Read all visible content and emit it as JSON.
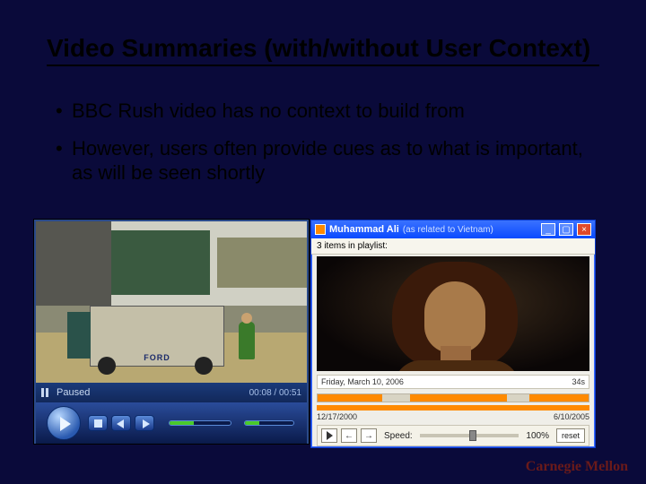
{
  "slide": {
    "title": "Video Summaries (with/without User Context)",
    "bullets": [
      "BBC Rush video has no context to build from",
      "However, users often provide cues as to what is important, as will be seen shortly"
    ]
  },
  "wmp": {
    "status": "Paused",
    "time": "00:08 / 00:51",
    "truck_brand": "FORD"
  },
  "xp": {
    "title_main": "Muhammad Ali",
    "title_sub": "(as related to Vietnam)",
    "playlist_count_text": "3 items in playlist:",
    "info_left": "Friday, March 10, 2006",
    "info_right": "34s",
    "date_start": "12/17/2000",
    "date_end": "6/10/2005",
    "speed_label": "Speed:",
    "speed_value": "100%",
    "reset_label": "reset"
  },
  "footer": {
    "logo": "Carnegie Mellon"
  }
}
